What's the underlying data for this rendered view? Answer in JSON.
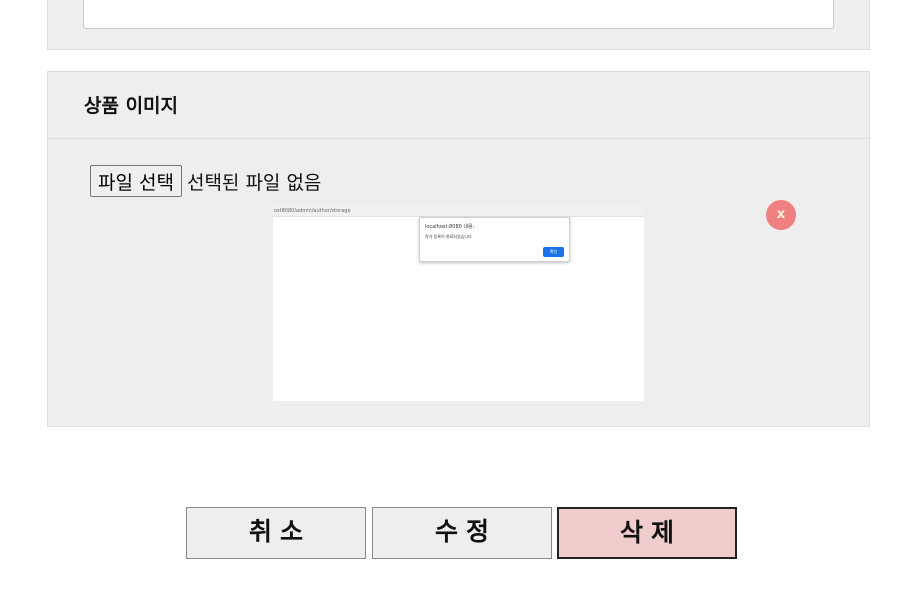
{
  "image_section": {
    "title": "상품 이미지",
    "file_input": {
      "button_label": "파일 선택",
      "status": "선택된 파일 없음"
    },
    "remove_label": "x",
    "preview": {
      "url": "ost8080/admin/author/storage",
      "dialog_title": "localhost:8080 내용:",
      "dialog_message": "작가 등록이 완료되었습니다",
      "dialog_button": "확인"
    }
  },
  "actions": {
    "cancel_label": "취소",
    "edit_label": "수정",
    "delete_label": "삭제"
  },
  "colors": {
    "panel_bg": "#eeeeee",
    "remove_bg": "#f08080",
    "delete_bg": "#f0cccc",
    "dialog_button": "#1a73e8"
  }
}
